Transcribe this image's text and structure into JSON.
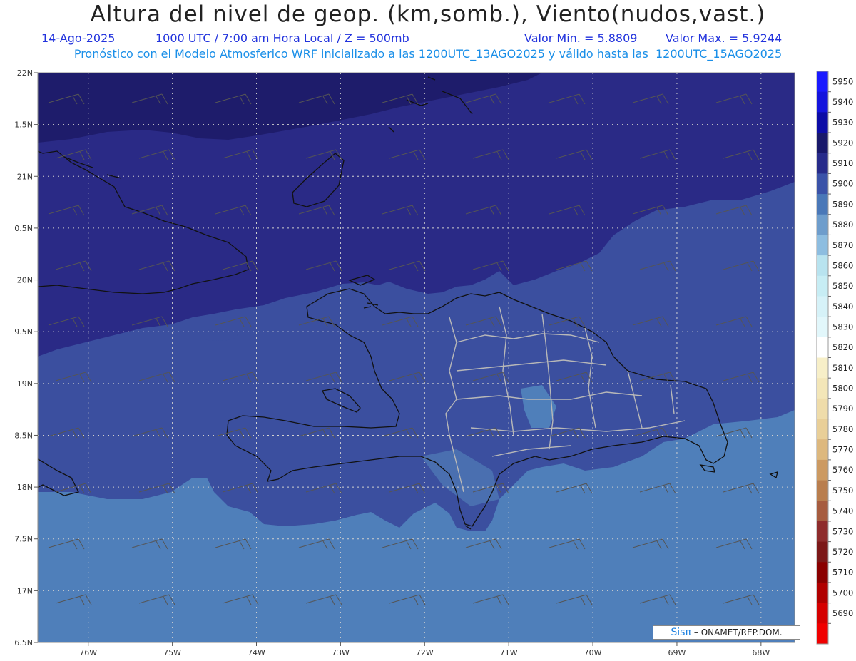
{
  "header": {
    "title": "Altura del nivel de geop. (km,somb.), Viento(nudos,vast.)",
    "date": "14-Ago-2025",
    "time": "1000 UTC / 7:00 am Hora Local / Z = 500mb",
    "min_label": "Valor Min. = 5.8809",
    "max_label": "Valor Max. = 5.9244",
    "forecast_line": "Pronóstico con el Modelo Atmosferico WRF inicializado a las 1200UTC_13AGO2025 y válido hasta las  1200UTC_15AGO2025"
  },
  "axes": {
    "lat_labels": [
      "22N",
      "1.5N",
      "21N",
      "0.5N",
      "20N",
      "9.5N",
      "19N",
      "8.5N",
      "18N",
      "7.5N",
      "17N",
      "6.5N"
    ],
    "lon_labels": [
      "76W",
      "75W",
      "74W",
      "73W",
      "72W",
      "71W",
      "70W",
      "69W",
      "68W"
    ],
    "lat_range": [
      16.5,
      22.0
    ],
    "lon_range": [
      -76.6,
      -67.6
    ]
  },
  "colorbar": {
    "levels": [
      5950,
      5940,
      5930,
      5920,
      5910,
      5900,
      5890,
      5880,
      5870,
      5860,
      5850,
      5840,
      5830,
      5820,
      5810,
      5800,
      5790,
      5780,
      5770,
      5760,
      5750,
      5740,
      5730,
      5720,
      5710,
      5700,
      5690
    ],
    "colors": [
      "#1a1aff",
      "#1414dd",
      "#0c0ca6",
      "#18186a",
      "#272b8a",
      "#3a52a8",
      "#4a78b8",
      "#6e9dcc",
      "#8dbde0",
      "#b8e3ef",
      "#c7edf4",
      "#d6f2f8",
      "#e2f7fb",
      "#ffffff",
      "#f7efc8",
      "#f3e6b8",
      "#efdcaa",
      "#e9cf98",
      "#ddb87e",
      "#cc9a62",
      "#b97e4e",
      "#a65c3f",
      "#8e2c2c",
      "#7c1818",
      "#8a0000",
      "#b00000",
      "#d50000",
      "#f00000"
    ]
  },
  "field": {
    "colors": {
      "z5920": "#1e1c6b",
      "z5910": "#2a2a86",
      "z5900": "#3b4f9f",
      "z5890": "#4f7fba",
      "z5880": "#5a8fc8",
      "coast": "#111111",
      "border": "#b8b8b8"
    }
  },
  "credit": {
    "logo": "Sisπ",
    "text": "– ONAMET/REP.DOM."
  }
}
